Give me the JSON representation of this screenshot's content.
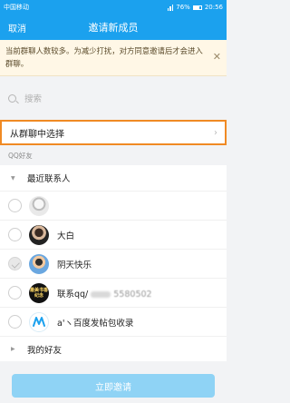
{
  "status": {
    "carrier": "中国移动",
    "battery": "76%",
    "time": "20:56"
  },
  "titlebar": {
    "cancel": "取消",
    "title": "邀请新成员"
  },
  "notice": {
    "text": "当前群聊人数较多。为减少打扰，对方同意邀请后才会进入群聊。",
    "close_icon": "close-icon"
  },
  "search": {
    "placeholder": "搜索"
  },
  "group_select": {
    "label": "从群聊中选择"
  },
  "section_label": "QQ好友",
  "categories": {
    "recent": "最近联系人",
    "friends": "我的好友"
  },
  "contacts": [
    {
      "name": "",
      "checked": false
    },
    {
      "name": "大白",
      "checked": false
    },
    {
      "name": "阴天快乐",
      "checked": true
    },
    {
      "name": "联系qq/",
      "suffix": "5580502",
      "checked": false
    },
    {
      "name": "a'ヽ百度发帖包收录",
      "checked": false
    }
  ],
  "avatar_badge_text": "最美书香纪念",
  "invite_button": "立即邀请",
  "colors": {
    "accent": "#1ba1ee",
    "highlight_border": "#f08a24",
    "button_disabled": "#8fd3f5"
  }
}
